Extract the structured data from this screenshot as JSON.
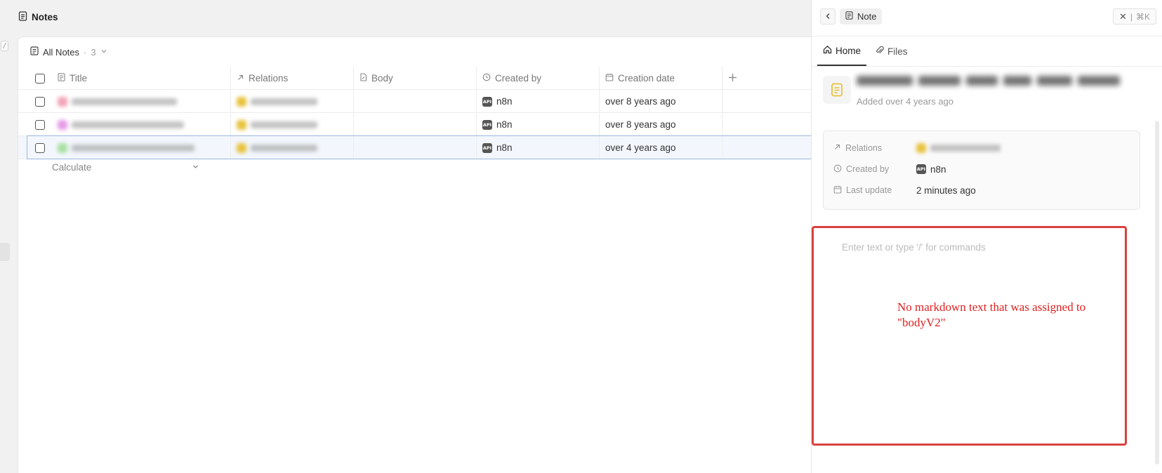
{
  "app": {
    "title": "Notes",
    "slash_hint": "/"
  },
  "view": {
    "name": "All Notes",
    "separator": "·",
    "count": "3"
  },
  "columns": [
    {
      "label": "Title",
      "icon": "doc-icon"
    },
    {
      "label": "Relations",
      "icon": "arrow-up-right-icon"
    },
    {
      "label": "Body",
      "icon": "doc-edit-icon"
    },
    {
      "label": "Created by",
      "icon": "history-icon"
    },
    {
      "label": "Creation date",
      "icon": "calendar-icon"
    }
  ],
  "rows": [
    {
      "title_color": "#f2a3b6",
      "rel_color": "#e8c23c",
      "created_by": "n8n",
      "date": "over 8 years ago"
    },
    {
      "title_color": "#e59ae6",
      "rel_color": "#e8c23c",
      "created_by": "n8n",
      "date": "over 8 years ago"
    },
    {
      "title_color": "#a9dfa0",
      "rel_color": "#e8c23c",
      "created_by": "n8n",
      "date": "over 4 years ago"
    }
  ],
  "api_badge": "API",
  "calculate": {
    "label": "Calculate"
  },
  "panel": {
    "type_label": "Note",
    "close_shortcut": "⌘K",
    "tabs": [
      {
        "label": "Home",
        "icon": "home-icon"
      },
      {
        "label": "Files",
        "icon": "paperclip-icon"
      }
    ],
    "record_subtitle": "Added over 4 years ago",
    "fields": {
      "relations_label": "Relations",
      "created_by_label": "Created by",
      "created_by_value": "n8n",
      "last_update_label": "Last update",
      "last_update_value": "2 minutes ago"
    },
    "editor_placeholder": "Enter text or type '/' for commands",
    "annotation": "No markdown text that was assigned to \"bodyV2\""
  },
  "colors": {
    "annotation": "#e02020",
    "accent_yellow": "#e8c23c",
    "selected_border": "#9ab7dd"
  }
}
